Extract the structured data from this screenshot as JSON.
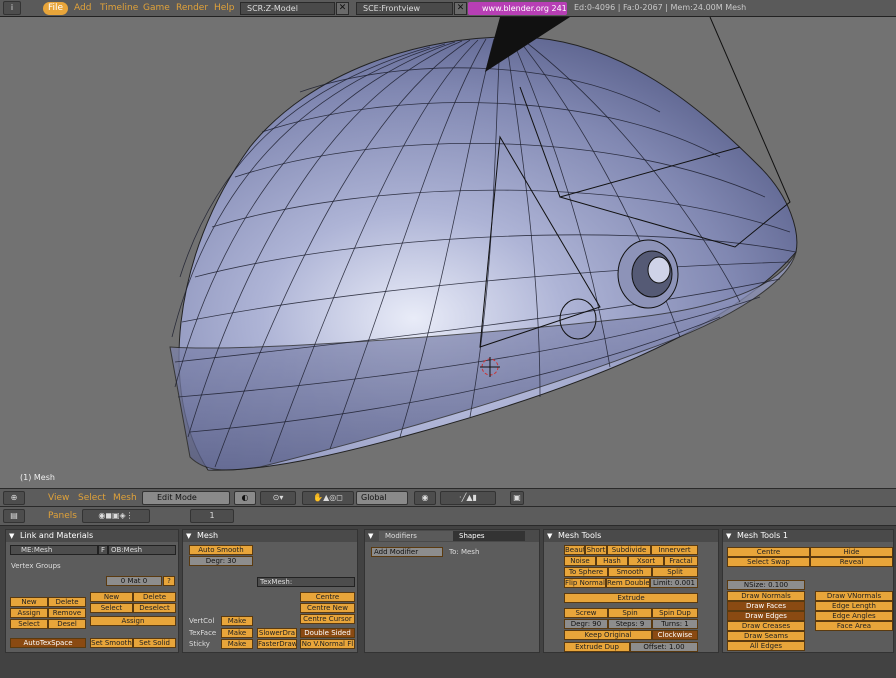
{
  "topbar": {
    "menu": [
      "File",
      "Add",
      "Timeline",
      "Game",
      "Render",
      "Help"
    ],
    "screen": "SCR:Z-Model",
    "scene": "SCE:Frontview",
    "url": "www.blender.org 241",
    "stats": "Ed:0-4096 | Fa:0-2067 | Mem:24.00M Mesh"
  },
  "viewport": {
    "object_label": "(1) Mesh"
  },
  "header3d": {
    "menus": [
      "View",
      "Select",
      "Mesh"
    ],
    "mode": "Edit Mode",
    "orientation": "Global"
  },
  "buttons_header": {
    "panels": "Panels",
    "frame": "1"
  },
  "link_materials": {
    "title": "Link and Materials",
    "me_field": "ME:Mesh",
    "f_label": "F",
    "ob_field": "OB:Mesh",
    "vertex_groups": "Vertex Groups",
    "mat": "0 Mat 0",
    "q": "?",
    "new": "New",
    "delete": "Delete",
    "assign": "Assign",
    "remove": "Remove",
    "select": "Select",
    "desel": "Desel",
    "new2": "New",
    "delete2": "Delete",
    "select2": "Select",
    "deselect2": "Deselect",
    "assign2": "Assign",
    "autotex": "AutoTexSpace",
    "set_smooth": "Set Smooth",
    "set_solid": "Set Solid"
  },
  "mesh": {
    "title": "Mesh",
    "auto_smooth": "Auto Smooth",
    "degr": "Degr: 30",
    "texmesh": "TexMesh:",
    "centre": "Centre",
    "centre_new": "Centre New",
    "centre_cursor": "Centre Cursor",
    "vertcol": "VertCol",
    "texface": "TexFace",
    "sticky": "Sticky",
    "make": "Make",
    "slower": "SlowerDra",
    "faster": "FasterDraw",
    "double_sided": "Double Sided",
    "no_vnormal": "No V.Normal Fl"
  },
  "modifiers": {
    "tab1": "Modifiers",
    "tab2": "Shapes",
    "add": "Add Modifier",
    "to": "To: Mesh"
  },
  "mesh_tools": {
    "title": "Mesh Tools",
    "beauty": "Beaut",
    "short": "Short",
    "subdivide": "Subdivide",
    "innervert": "Innervert",
    "noise": "Noise",
    "hash": "Hash",
    "xsort": "Xsort",
    "fractal": "Fractal",
    "to_sphere": "To Sphere",
    "smooth": "Smooth",
    "split": "Split",
    "flip_normals": "Flip Normals",
    "rem_doubles": "Rem Doubles",
    "limit": "Limit: 0.001",
    "extrude": "Extrude",
    "screw": "Screw",
    "spin": "Spin",
    "spin_dup": "Spin Dup",
    "degr": "Degr: 90",
    "steps": "Steps: 9",
    "turns": "Turns: 1",
    "keep_original": "Keep Original",
    "clockwise": "Clockwise",
    "extrude_dup": "Extrude Dup",
    "offset": "Offset: 1.00"
  },
  "mesh_tools1": {
    "title": "Mesh Tools 1",
    "centre": "Centre",
    "hide": "Hide",
    "select_swap": "Select Swap",
    "reveal": "Reveal",
    "nsize": "NSize: 0.100",
    "draw_normals": "Draw Normals",
    "draw_vnormals": "Draw VNormals",
    "draw_faces": "Draw Faces",
    "edge_length": "Edge Length",
    "draw_edges": "Draw Edges",
    "edge_angles": "Edge Angles",
    "draw_creases": "Draw Creases",
    "face_area": "Face Area",
    "draw_seams": "Draw Seams",
    "all_edges": "All Edges"
  }
}
